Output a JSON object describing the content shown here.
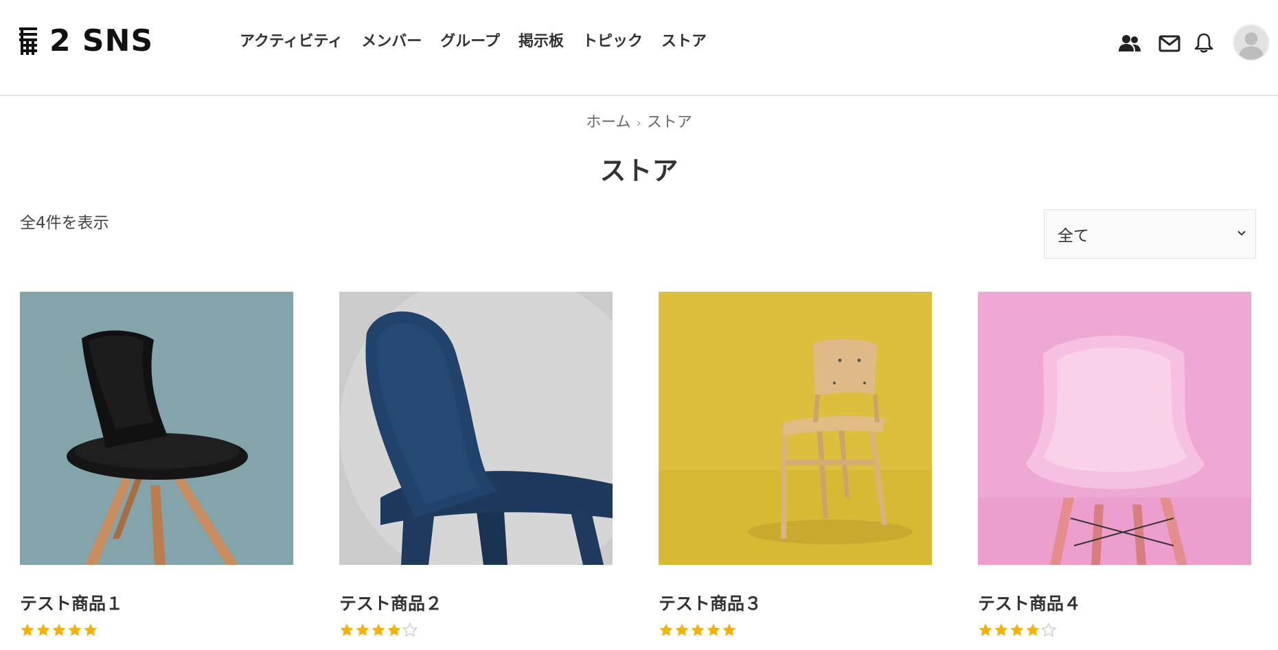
{
  "site": {
    "logo_text": "2 SNS"
  },
  "nav": {
    "items": [
      {
        "label": "アクティビティ"
      },
      {
        "label": "メンバー"
      },
      {
        "label": "グループ"
      },
      {
        "label": "掲示板"
      },
      {
        "label": "トピック"
      },
      {
        "label": "ストア"
      }
    ]
  },
  "header_icons": [
    "members-icon",
    "mail-icon",
    "bell-icon",
    "avatar"
  ],
  "breadcrumb": {
    "home": "ホーム",
    "current": "ストア"
  },
  "page": {
    "title": "ストア",
    "result_count": "全4件を表示"
  },
  "sort": {
    "selected": "全て"
  },
  "colors": {
    "star": "#f5b301",
    "star_empty": "#cccccc"
  },
  "products": [
    {
      "name": "テスト商品１",
      "rating": 5,
      "image_desc": "black chair on teal background",
      "bg": "#84a4ab"
    },
    {
      "name": "テスト商品２",
      "rating": 4,
      "image_desc": "navy chair on grey background",
      "bg": "#cbcbcb"
    },
    {
      "name": "テスト商品３",
      "rating": 5,
      "image_desc": "wooden chair on yellow background",
      "bg": "#dcbf3c"
    },
    {
      "name": "テスト商品４",
      "rating": 4,
      "image_desc": "pink chair on pink background",
      "bg": "#eea8d4"
    }
  ]
}
